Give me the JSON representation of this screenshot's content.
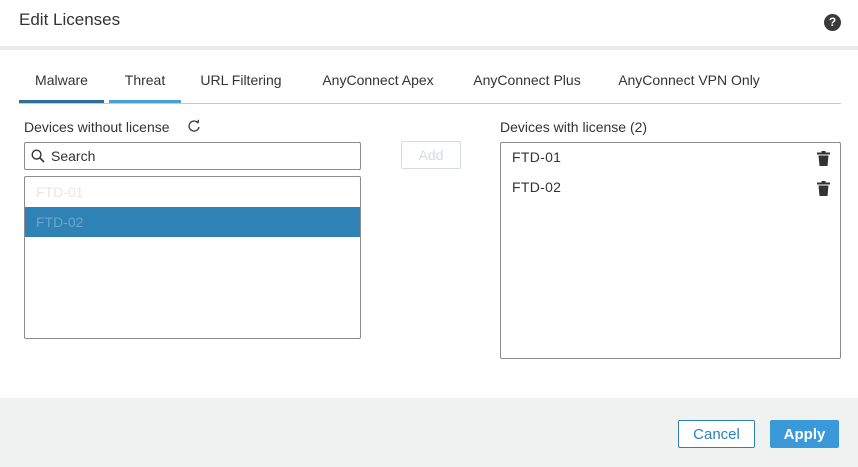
{
  "dialog": {
    "title": "Edit Licenses",
    "help_icon": "help-icon",
    "help_glyph": "?"
  },
  "tabs": [
    {
      "label": "Malware"
    },
    {
      "label": "Threat"
    },
    {
      "label": "URL Filtering"
    },
    {
      "label": "AnyConnect Apex"
    },
    {
      "label": "AnyConnect Plus"
    },
    {
      "label": "AnyConnect VPN Only"
    }
  ],
  "left_panel": {
    "label": "Devices without license",
    "refresh_icon": "refresh-icon",
    "search": {
      "placeholder": "Search",
      "value": "",
      "icon": "search-icon"
    },
    "items": [
      {
        "label": "FTD-01",
        "selected": false
      },
      {
        "label": "FTD-02",
        "selected": true
      }
    ]
  },
  "add_button": {
    "label": "Add"
  },
  "right_panel": {
    "label": "Devices with license (2)",
    "items": [
      {
        "label": "FTD-01",
        "icon": "trash-icon"
      },
      {
        "label": "FTD-02",
        "icon": "trash-icon"
      }
    ]
  },
  "footer": {
    "cancel_label": "Cancel",
    "apply_label": "Apply"
  },
  "colors": {
    "accent": "#3a9ad9",
    "selected_row": "#2e82b5",
    "active_tab": "#2f6f99",
    "footer_bg": "#f0f2f2"
  }
}
